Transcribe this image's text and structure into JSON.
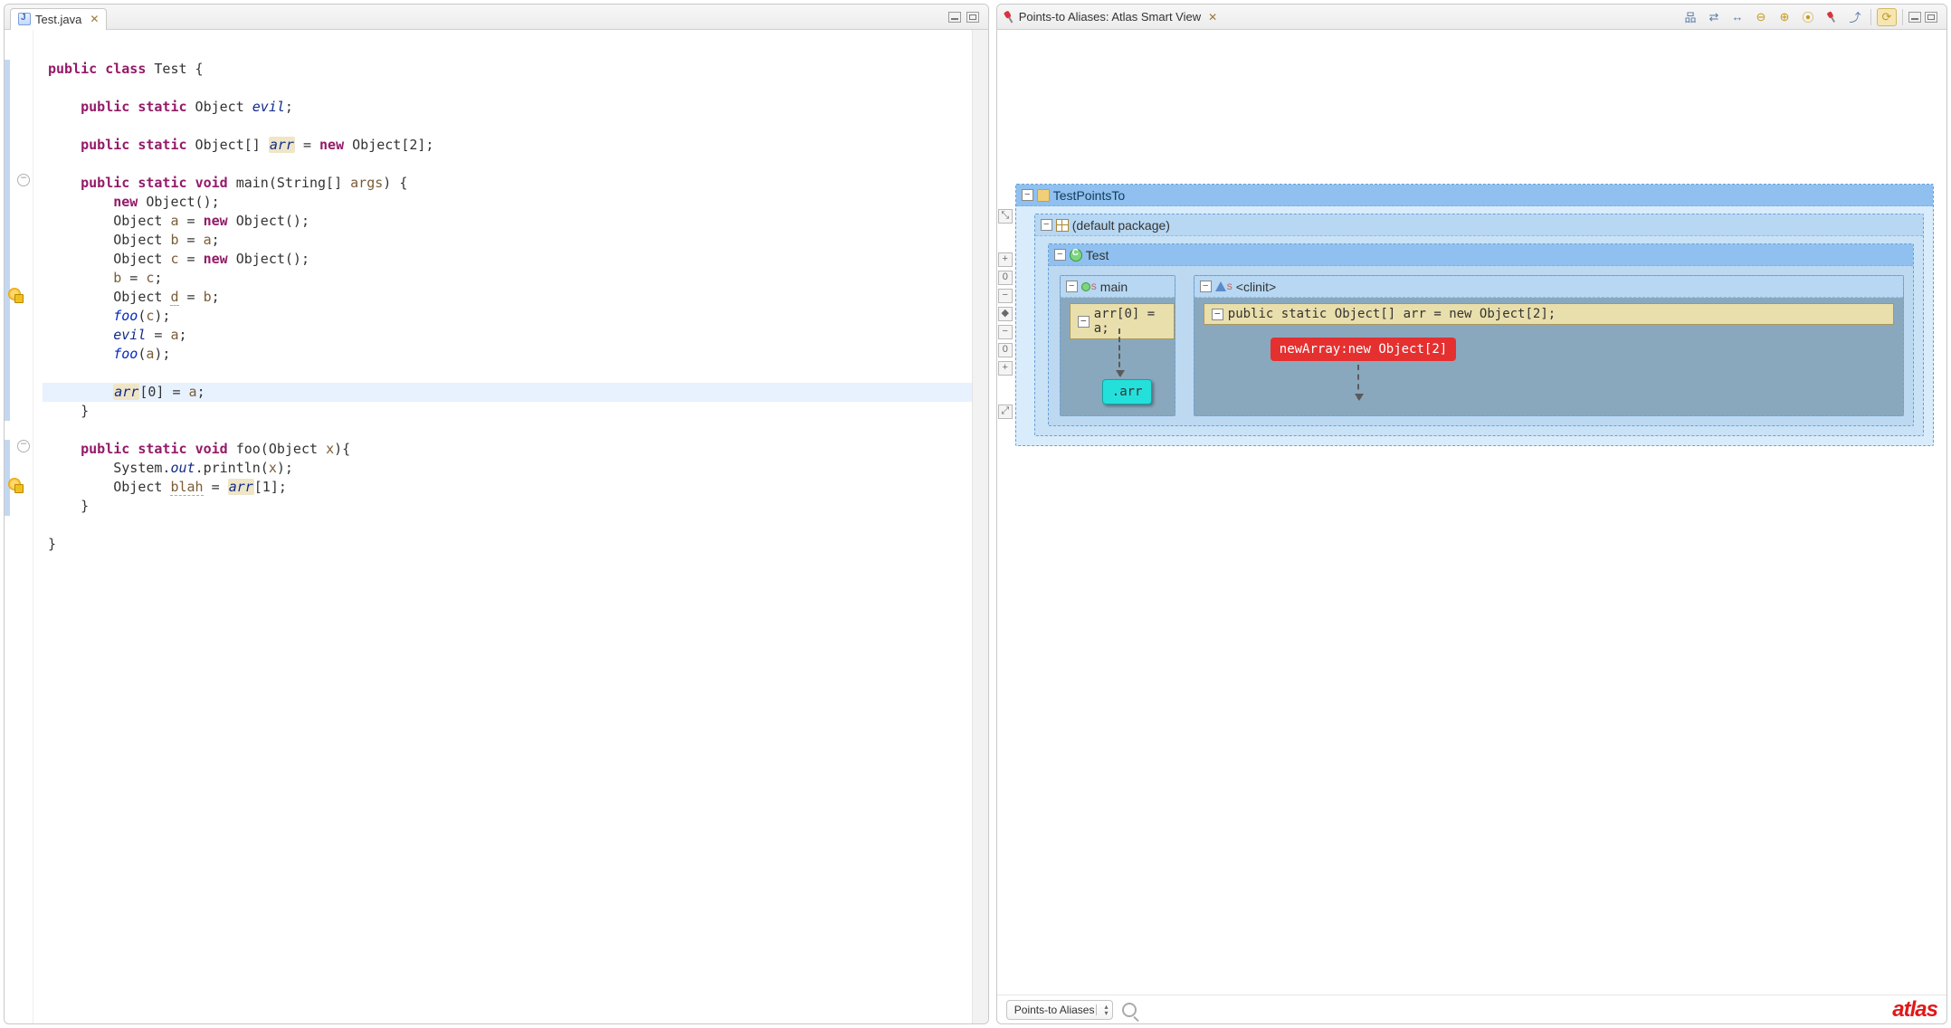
{
  "editor": {
    "tab_label": "Test.java",
    "lines": [
      "",
      "<span class='kw'>public</span> <span class='kw'>class</span> Test {",
      "",
      "    <span class='kw'>public</span> <span class='kw'>static</span> Object <span class='fld'>evil</span>;",
      "",
      "    <span class='kw'>public</span> <span class='kw'>static</span> Object[] <span class='fld boxed'>arr</span> = <span class='kw'>new</span> Object[2];",
      "",
      "    <span class='kw'>public</span> <span class='kw'>static</span> <span class='kw'>void</span> main(String[] <span class='arg'>args</span>) {",
      "        <span class='kw'>new</span> Object();",
      "        Object <span class='arg'>a</span> = <span class='kw'>new</span> Object();",
      "        Object <span class='arg'>b</span> = <span class='arg'>a</span>;",
      "        Object <span class='arg'>c</span> = <span class='kw'>new</span> Object();",
      "        <span class='arg'>b</span> = <span class='arg'>c</span>;",
      "        Object <span class='arg under'>d</span> = <span class='arg'>b</span>;",
      "        <span class='fld2'>foo</span>(<span class='arg'>c</span>);",
      "        <span class='fld'>evil</span> = <span class='arg'>a</span>;",
      "        <span class='fld2'>foo</span>(<span class='arg'>a</span>);",
      "",
      "        <span class='fld boxed'>arr</span>[0] = <span class='arg'>a</span>;",
      "    }",
      "",
      "    <span class='kw'>public</span> <span class='kw'>static</span> <span class='kw'>void</span> foo(Object <span class='arg'>x</span>){",
      "        System.<span class='fld'>out</span>.println(<span class='arg'>x</span>);",
      "        Object <span class='arg under'>blah</span> = <span class='fld boxed'>arr</span>[1];",
      "    }",
      "",
      "}"
    ],
    "highlight_line_index": 18
  },
  "gutter": {
    "blue_ranges": [
      [
        1,
        20
      ],
      [
        21,
        25
      ]
    ],
    "fold_markers": [
      7,
      21
    ],
    "warnings": [
      13,
      23
    ]
  },
  "atlas": {
    "view_title": "Points-to Aliases: Atlas Smart View",
    "toolbar_icons": [
      "hierarchy",
      "link-nodes",
      "fit-width",
      "zoom-out",
      "zoom-in",
      "zoom-reset",
      "pin",
      "export",
      "sync"
    ],
    "project": "TestPointsTo",
    "package": "(default package)",
    "class": "Test",
    "methods": {
      "main": {
        "name": "main",
        "stmt": "arr[0] = a;",
        "target": ".arr"
      },
      "clinit": {
        "name": "<clinit>",
        "stmt": "public static Object[] arr = new Object[2];",
        "alloc": "newArray:new Object[2]"
      }
    },
    "combo_value": "Points-to Aliases",
    "logo": "atlas"
  }
}
